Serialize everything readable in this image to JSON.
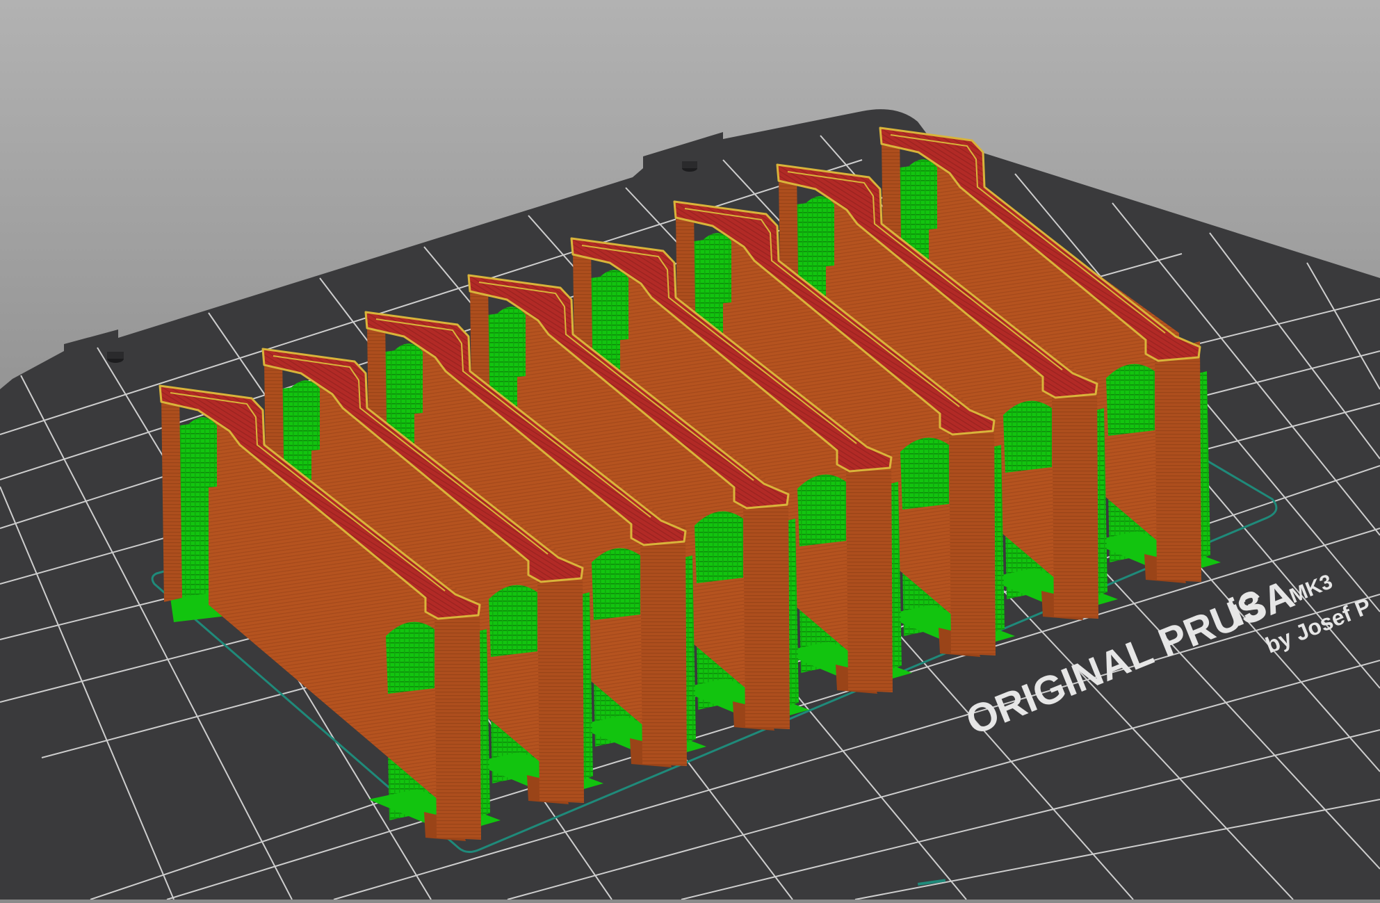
{
  "viewport": {
    "label": "3D preview",
    "background_top": "#b2b2b2",
    "background_bottom": "#6f6f6f"
  },
  "bed": {
    "brand_text": "ORIGINAL PRUSA",
    "model_text": "i3",
    "variant_text": "MK3",
    "maker_text": "by Josef P",
    "bed_color": "#3a3a3c",
    "grid_color": "#e8e8e8",
    "skirt_color": "#1f8a7a"
  },
  "print_objects": {
    "count": 8,
    "perimeter_color": "#b5531f",
    "top_solid_color": "#b22a26",
    "edge_color": "#d9b43a",
    "support_color": "#12c40f",
    "support_dark_color": "#0d8a0b"
  }
}
